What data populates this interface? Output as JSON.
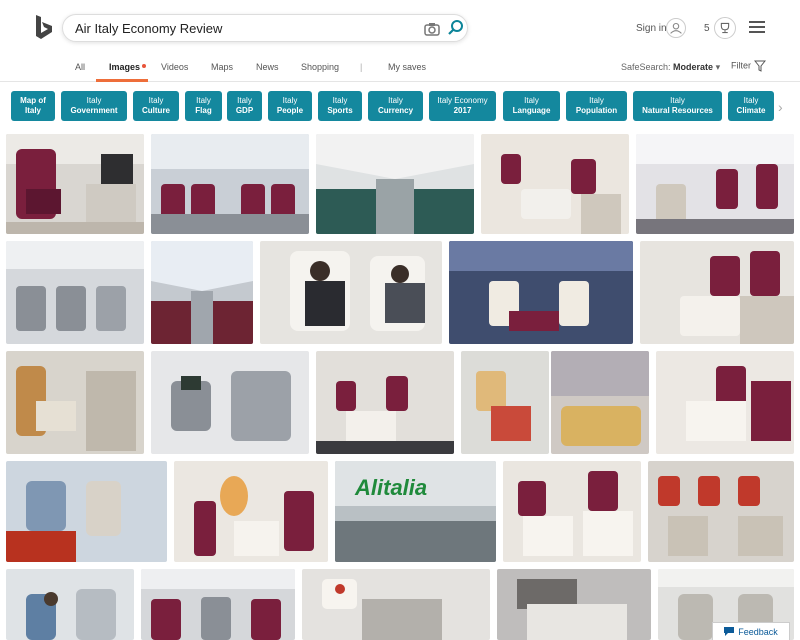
{
  "search": {
    "query": "Air Italy Economy Review"
  },
  "account": {
    "signin": "Sign in",
    "rewards": "5"
  },
  "nav": {
    "tabs": [
      "All",
      "Images",
      "Videos",
      "Maps",
      "News",
      "Shopping",
      "|",
      "My saves"
    ],
    "active": "Images",
    "safesearch_label": "SafeSearch:",
    "safesearch_value": "Moderate",
    "filter_label": "Filter"
  },
  "pills": [
    {
      "line1": "Map of",
      "line2": "Italy",
      "bold": "both"
    },
    {
      "line1": "Italy",
      "line2": "Government"
    },
    {
      "line1": "Italy",
      "line2": "Culture"
    },
    {
      "line1": "Italy",
      "line2": "Flag"
    },
    {
      "line1": "Italy",
      "line2": "GDP"
    },
    {
      "line1": "Italy",
      "line2": "People"
    },
    {
      "line1": "Italy",
      "line2": "Sports"
    },
    {
      "line1": "Italy",
      "line2": "Currency"
    },
    {
      "line1": "Italy Economy",
      "line2": "2017"
    },
    {
      "line1": "Italy",
      "line2": "Language"
    },
    {
      "line1": "Italy",
      "line2": "Population"
    },
    {
      "line1": "Italy",
      "line2": "Natural Resources"
    },
    {
      "line1": "Italy",
      "line2": "Climate"
    }
  ],
  "images": {
    "logo_text": "Alitalia"
  },
  "feedback": "Feedback",
  "colors": {
    "accent": "#14889e",
    "brand": "#ee6e3a",
    "seat_red": "#7a1f3d",
    "seat_grey": "#8a8f96"
  }
}
